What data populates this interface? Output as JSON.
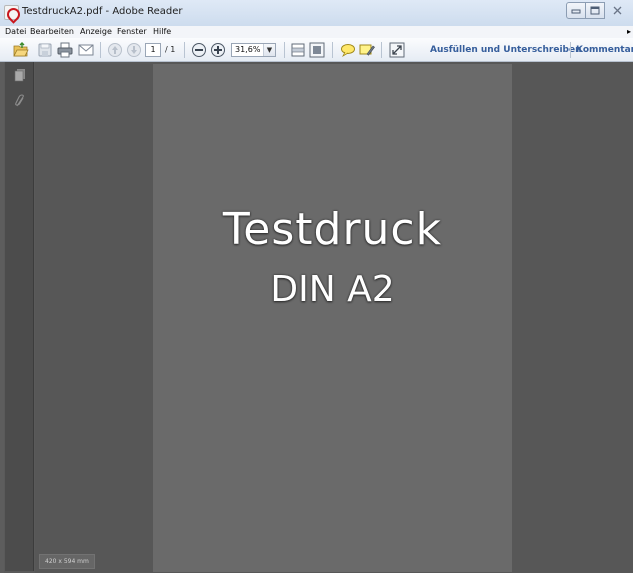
{
  "window": {
    "title": "TestdruckA2.pdf - Adobe Reader",
    "controls": [
      "minimize",
      "maximize",
      "close"
    ]
  },
  "menu": {
    "items": [
      "Datei",
      "Bearbeiten",
      "Anzeige",
      "Fenster",
      "Hilfe"
    ]
  },
  "toolbar": {
    "icons": [
      "open-icon",
      "save-icon",
      "print-icon",
      "email-icon",
      "prev-page-icon",
      "next-page-icon",
      "zoom-out-icon",
      "zoom-in-icon",
      "scroll-mode-icon",
      "fit-page-icon",
      "comment-icon",
      "highlight-icon",
      "fullscreen-icon"
    ],
    "page_current": "1",
    "page_total": "/ 1",
    "zoom": "31,6%",
    "fill_sign_label": "Ausfüllen und Unterschreiben",
    "comment_label": "Kommentar"
  },
  "document": {
    "title": "Testdruck",
    "subtitle": "DIN A2",
    "page_size": "420 x 594 mm"
  },
  "colors": {
    "toolbar_link": "#365e9c",
    "document_bg": "#575757",
    "page_bg": "#6a6a6a"
  }
}
